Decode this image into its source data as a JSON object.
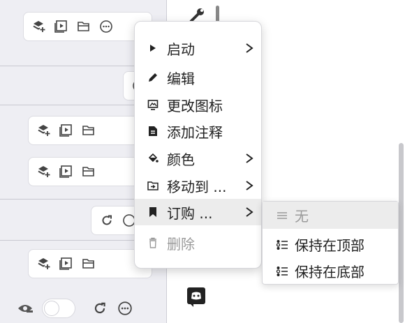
{
  "context_menu": {
    "items": [
      {
        "label": "启动",
        "icon": "play-triangle-icon",
        "has_submenu": true
      },
      {
        "label": "编辑",
        "icon": "pencil-icon",
        "has_submenu": false
      },
      {
        "label": "更改图标",
        "icon": "image-icon",
        "has_submenu": false
      },
      {
        "label": "添加注释",
        "icon": "note-icon",
        "has_submenu": false
      },
      {
        "label": "颜色",
        "icon": "paint-bucket-icon",
        "has_submenu": true
      },
      {
        "label": "移动到 ...",
        "icon": "move-folder-icon",
        "has_submenu": true
      },
      {
        "label": "订购 ...",
        "icon": "bookmark-icon",
        "has_submenu": true,
        "active": true
      },
      {
        "label": "删除",
        "icon": "trash-icon",
        "has_submenu": false,
        "disabled": true
      }
    ]
  },
  "order_submenu": {
    "items": [
      {
        "label": "无",
        "icon": "menu-lines-icon",
        "disabled": true
      },
      {
        "label": "保持在顶部",
        "icon": "list-bullets-icon"
      },
      {
        "label": "保持在底部",
        "icon": "list-bullets-icon"
      }
    ]
  },
  "colors": {
    "panel_bg": "#eeeef3",
    "menu_active_bg": "#ececec",
    "disabled_text": "#9a9a9a"
  }
}
